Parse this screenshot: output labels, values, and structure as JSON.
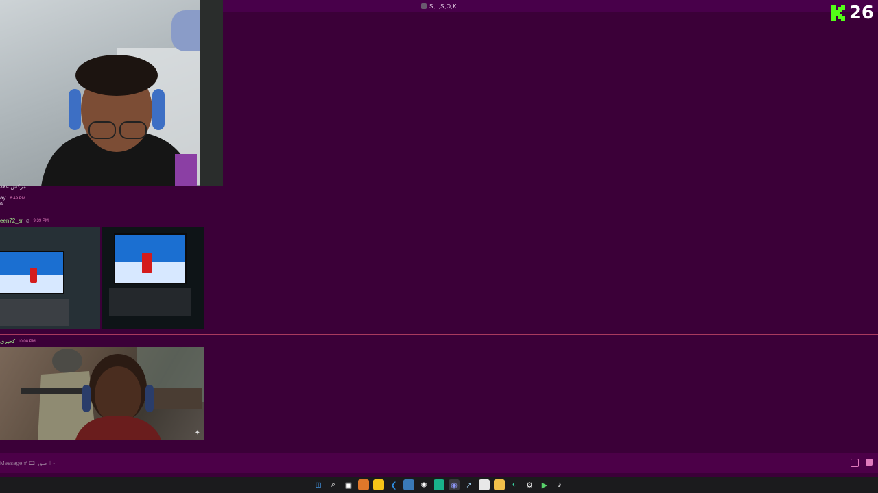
{
  "window": {
    "title": "S,L,S,O,K"
  },
  "kick": {
    "viewer_count": "26",
    "brand_color": "#53fc18"
  },
  "messages": [
    {
      "author": "مركس عقة",
      "time": "",
      "text": ""
    },
    {
      "author": "ay",
      "time": "6:49 PM",
      "text": "a"
    },
    {
      "author": "een72_sr",
      "time": "9:39 PM",
      "attachments": [
        "tv-photo-1",
        "tv-photo-2"
      ]
    },
    {
      "author": "كحيري",
      "time": "10:08 PM",
      "attachments": [
        "game-stream-photo"
      ]
    }
  ],
  "composer": {
    "placeholder": "Message # 🎞 اا صور -"
  },
  "colors": {
    "background": "#3b0038",
    "titlebar": "#48004a",
    "composer": "#4c0048",
    "timestamp": "#e07bbd",
    "new_divider": "#a83a5e",
    "username_green": "#9fe08a"
  },
  "taskbar": {
    "items": [
      "windows-start-icon",
      "search-icon",
      "task-view-icon",
      "app-orange-icon",
      "app-yellow-icon",
      "vscode-icon",
      "app-gallery-icon",
      "chatgpt-icon",
      "app-green-icon",
      "discord-icon",
      "steam-icon",
      "calendar-icon",
      "file-explorer-icon",
      "edge-icon",
      "settings-icon",
      "play-icon",
      "tiktok-icon"
    ]
  }
}
